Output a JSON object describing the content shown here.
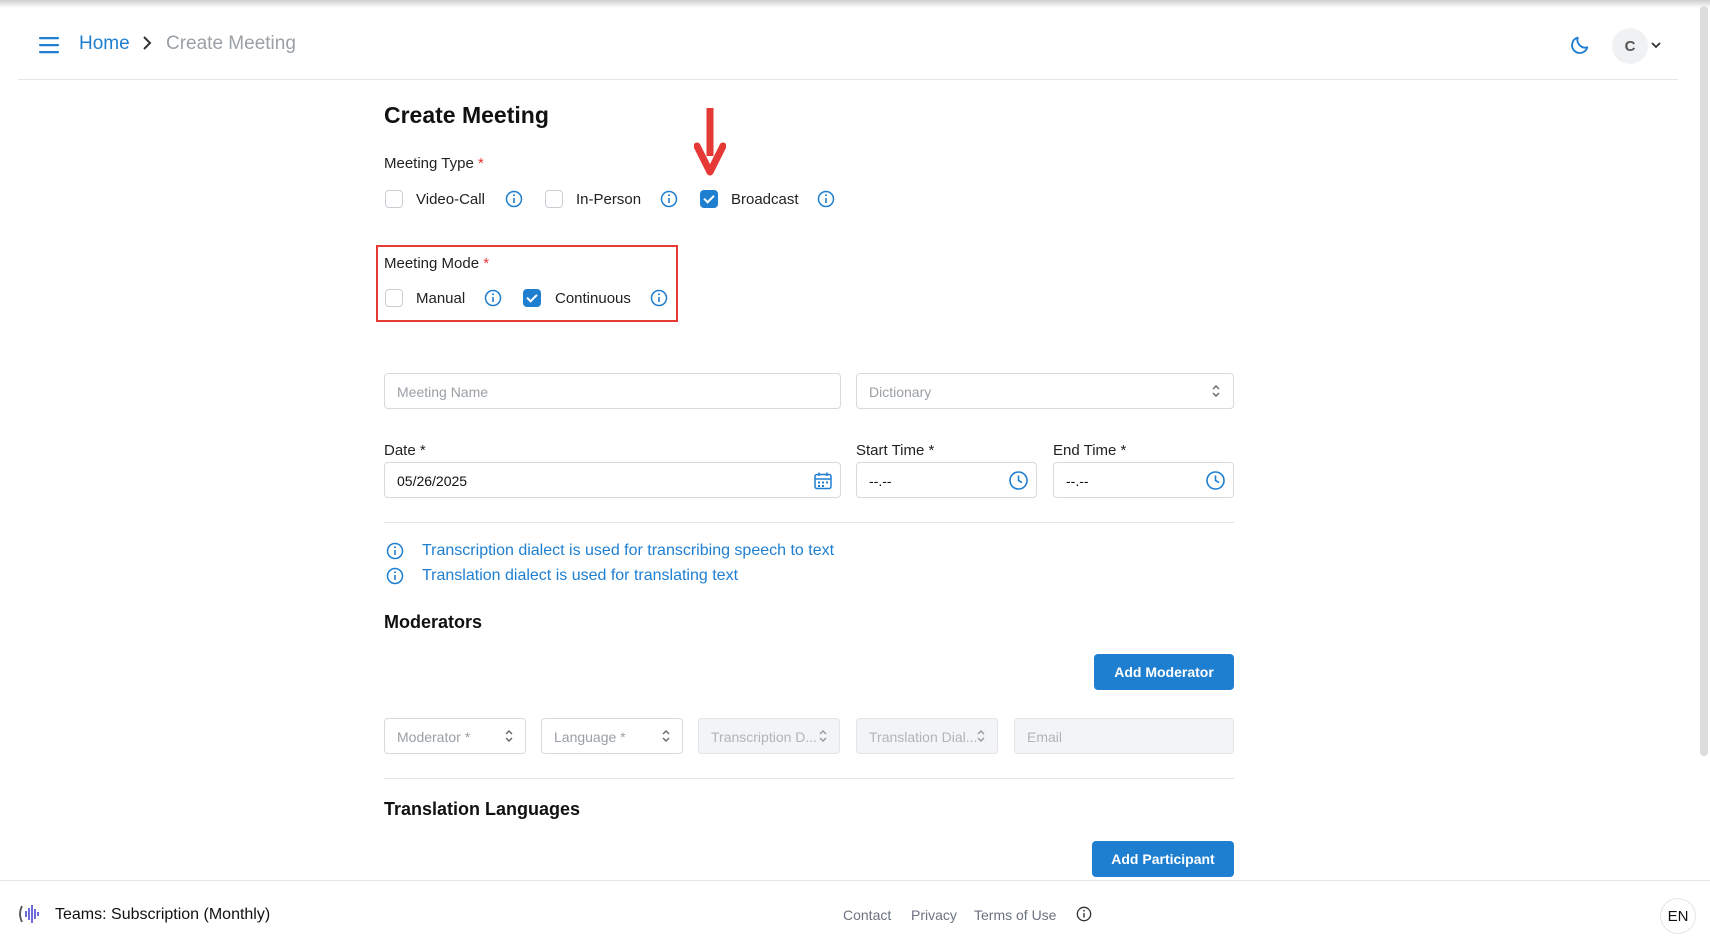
{
  "breadcrumb": {
    "home": "Home",
    "current": "Create Meeting"
  },
  "user": {
    "avatar_initial": "C"
  },
  "page": {
    "title": "Create Meeting"
  },
  "meeting_type": {
    "label": "Meeting Type",
    "required_mark": "*",
    "options": [
      {
        "label": "Video-Call",
        "checked": false
      },
      {
        "label": "In-Person",
        "checked": false
      },
      {
        "label": "Broadcast",
        "checked": true
      }
    ]
  },
  "meeting_mode": {
    "label": "Meeting Mode",
    "required_mark": "*",
    "options": [
      {
        "label": "Manual",
        "checked": false
      },
      {
        "label": "Continuous",
        "checked": true
      }
    ]
  },
  "form": {
    "meeting_name_placeholder": "Meeting Name",
    "dictionary_placeholder": "Dictionary",
    "date_label": "Date *",
    "date_value": "05/26/2025",
    "start_time_label": "Start Time *",
    "start_time_value": "--.--",
    "end_time_label": "End Time *",
    "end_time_value": "--.--"
  },
  "notes": [
    "Transcription dialect is used for transcribing speech to text",
    "Translation dialect is used for translating text"
  ],
  "moderators": {
    "title": "Moderators",
    "add_button": "Add Moderator",
    "fields": {
      "moderator": "Moderator *",
      "language": "Language *",
      "transcription": "Transcription D...",
      "translation": "Translation Dial...",
      "email": "Email"
    }
  },
  "translation_languages": {
    "title": "Translation Languages",
    "add_button": "Add Participant"
  },
  "footer": {
    "plan": "Teams: Subscription (Monthly)",
    "links": [
      "Contact",
      "Privacy",
      "Terms of Use"
    ],
    "language": "EN"
  },
  "colors": {
    "accent": "#1e7fd1",
    "annotation": "#e53935"
  }
}
